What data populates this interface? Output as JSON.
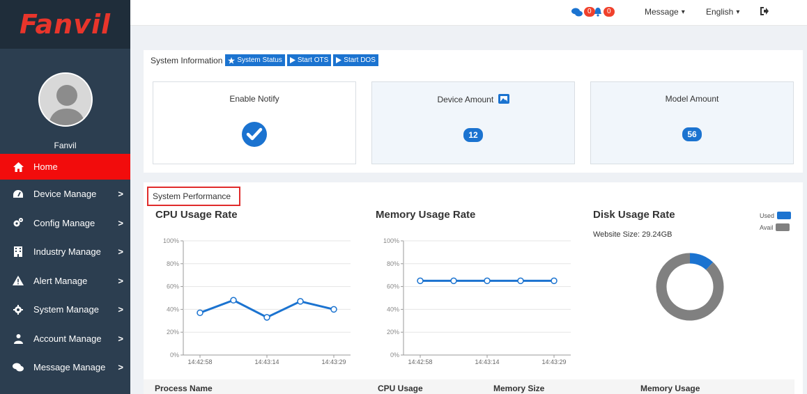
{
  "brand": {
    "logo_text": "Fanvil"
  },
  "user": {
    "name": "Fanvil"
  },
  "sidebar": {
    "items": [
      {
        "label": "Home",
        "icon": "home-icon",
        "active": true
      },
      {
        "label": "Device Manage",
        "icon": "dashboard-icon"
      },
      {
        "label": "Config Manage",
        "icon": "cogs-icon"
      },
      {
        "label": "Industry Manage",
        "icon": "building-icon"
      },
      {
        "label": "Alert Manage",
        "icon": "warning-icon"
      },
      {
        "label": "System Manage",
        "icon": "gear-icon"
      },
      {
        "label": "Account Manage",
        "icon": "users-icon"
      },
      {
        "label": "Message Manage",
        "icon": "comments-icon"
      }
    ],
    "chevron": ">"
  },
  "header": {
    "messages_count": "0",
    "alerts_count": "0",
    "message_menu": "Message",
    "language_menu": "English",
    "caret": "▾"
  },
  "system_info": {
    "title": "System Information",
    "buttons": [
      "System Status",
      "Start OTS",
      "Start DOS"
    ],
    "cards": [
      {
        "title": "Enable Notify"
      },
      {
        "title": "Device Amount",
        "value": "12"
      },
      {
        "title": "Model Amount",
        "value": "56"
      }
    ]
  },
  "performance": {
    "title": "System Performance",
    "disk_site_size": "Website Size: 29.24GB",
    "legend_used": "Used",
    "legend_avail": "Avail"
  },
  "table": {
    "headers": [
      "Process Name",
      "CPU Usage",
      "Memory Size",
      "Memory Usage"
    ]
  },
  "colors": {
    "accent": "#1b73d0",
    "active": "#f20c0c",
    "sidebar": "#2c3e50",
    "avail": "#808080"
  },
  "chart_data": [
    {
      "type": "line",
      "title": "CPU Usage Rate",
      "x": [
        "14:42:58",
        "",
        "14:43:14",
        "",
        "14:43:29"
      ],
      "x_tick_labels": [
        "14:42:58",
        "14:43:14",
        "14:43:29"
      ],
      "series": [
        {
          "values": [
            37,
            48,
            33,
            47,
            40
          ]
        }
      ],
      "y_ticks": [
        "0%",
        "20%",
        "40%",
        "60%",
        "80%",
        "100%"
      ],
      "ylim": [
        0,
        100
      ]
    },
    {
      "type": "line",
      "title": "Memory Usage Rate",
      "x": [
        "14:42:58",
        "",
        "14:43:14",
        "",
        "14:43:29"
      ],
      "x_tick_labels": [
        "14:42:58",
        "14:43:14",
        "14:43:29"
      ],
      "series": [
        {
          "values": [
            65,
            65,
            65,
            65,
            65
          ]
        }
      ],
      "y_ticks": [
        "0%",
        "20%",
        "40%",
        "60%",
        "80%",
        "100%"
      ],
      "ylim": [
        0,
        100
      ]
    },
    {
      "type": "pie",
      "title": "Disk Usage Rate",
      "categories": [
        "Used",
        "Avail"
      ],
      "values": [
        12,
        88
      ]
    }
  ]
}
